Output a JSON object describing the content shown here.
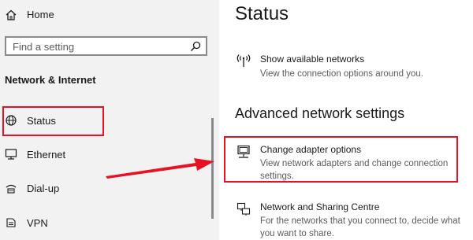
{
  "sidebar": {
    "home_label": "Home",
    "search_placeholder": "Find a setting",
    "section_heading": "Network & Internet",
    "items": [
      {
        "label": "Status",
        "icon": "globe-icon"
      },
      {
        "label": "Ethernet",
        "icon": "ethernet-icon"
      },
      {
        "label": "Dial-up",
        "icon": "dialup-icon"
      },
      {
        "label": "VPN",
        "icon": "vpn-icon"
      }
    ]
  },
  "main": {
    "title": "Status",
    "show_networks": {
      "title": "Show available networks",
      "desc": "View the connection options around you.",
      "icon": "antenna-icon"
    },
    "advanced_heading": "Advanced network settings",
    "options": [
      {
        "title": "Change adapter options",
        "desc": "View network adapters and change connection settings.",
        "icon": "adapter-icon"
      },
      {
        "title": "Network and Sharing Centre",
        "desc": "For the networks that you connect to, decide what you want to share.",
        "icon": "sharing-icon"
      }
    ]
  },
  "annotations": {
    "highlight_color": "#e81123",
    "arrow_color": "#e81123"
  }
}
